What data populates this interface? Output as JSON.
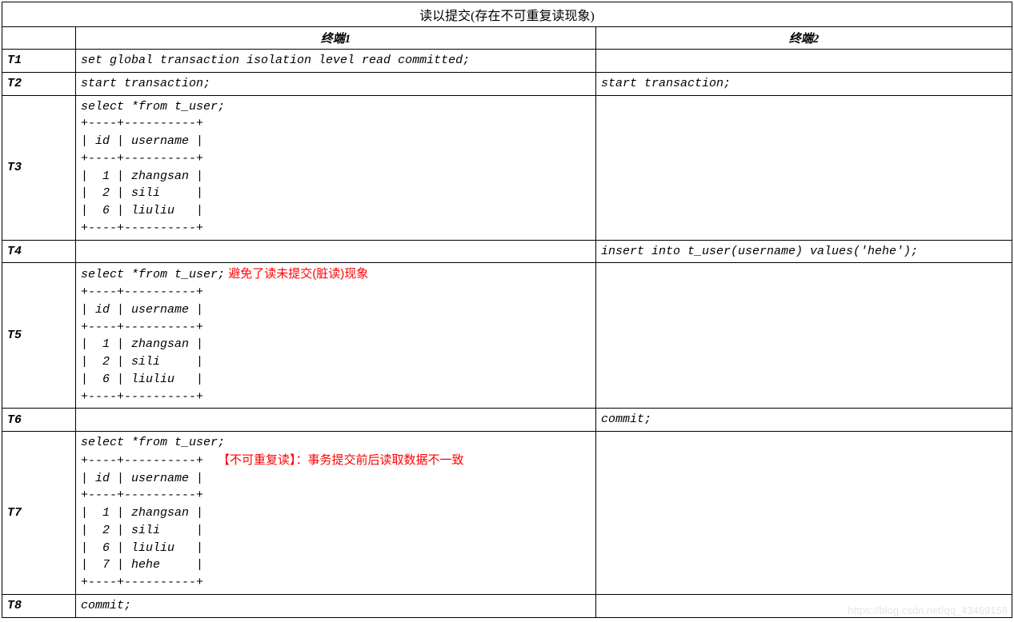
{
  "title": "读以提交(存在不可重复读现象)",
  "headers": {
    "col0": "",
    "col1": "终端1",
    "col2": "终端2"
  },
  "rows": [
    {
      "step": "T1",
      "t1": "set global transaction isolation level read committed;",
      "t2": ""
    },
    {
      "step": "T2",
      "t1": "start transaction;",
      "t2": "start transaction;"
    },
    {
      "step": "T3",
      "t1": "select *from t_user;\n+----+----------+\n| id | username |\n+----+----------+\n|  1 | zhangsan |\n|  2 | sili     |\n|  6 | liuliu   |\n+----+----------+",
      "t2": ""
    },
    {
      "step": "T4",
      "t1": "",
      "t2": "insert into t_user(username) values('hehe');"
    },
    {
      "step": "T5",
      "t1_pre": "select *from t_user;",
      "t1_annot": " 避免了读未提交(脏读)现象",
      "t1_post": "\n+----+----------+\n| id | username |\n+----+----------+\n|  1 | zhangsan |\n|  2 | sili     |\n|  6 | liuliu   |\n+----+----------+",
      "t2": ""
    },
    {
      "step": "T6",
      "t1": "",
      "t2": "commit;"
    },
    {
      "step": "T7",
      "t1_line1": "select *from t_user;",
      "t1_line2": "+----+----------+  ",
      "t1_annot": "【不可重复读】：事务提交前后读取数据不一致",
      "t1_post": "\n| id | username |\n+----+----------+\n|  1 | zhangsan |\n|  2 | sili     |\n|  6 | liuliu   |\n|  7 | hehe     |\n+----+----------+",
      "t2": ""
    },
    {
      "step": "T8",
      "t1": "commit;",
      "t2": ""
    }
  ],
  "watermark": "https://blog.csdn.net/qq_43469158"
}
